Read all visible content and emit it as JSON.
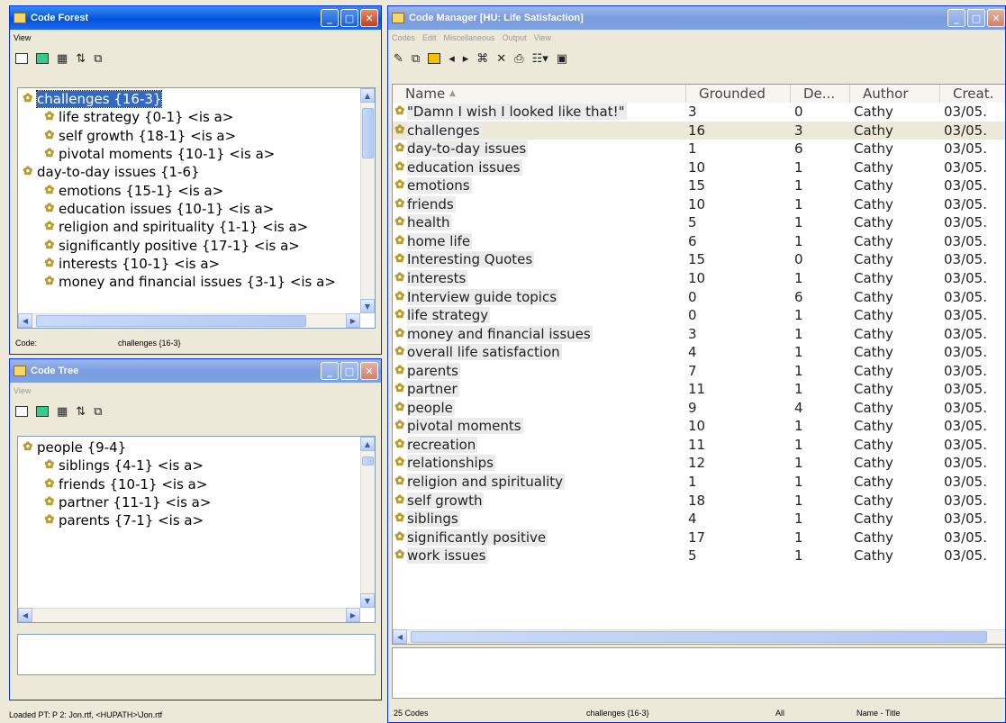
{
  "code_forest": {
    "title": "Code Forest",
    "menu": [
      "View"
    ],
    "tree": [
      {
        "label": "challenges {16-3}",
        "level": 0,
        "selected": true
      },
      {
        "label": "life strategy {0-1} <is a>",
        "level": 1
      },
      {
        "label": "self growth {18-1} <is a>",
        "level": 1
      },
      {
        "label": "pivotal moments {10-1} <is a>",
        "level": 1
      },
      {
        "label": "day-to-day issues {1-6}",
        "level": 0
      },
      {
        "label": "emotions {15-1} <is a>",
        "level": 1
      },
      {
        "label": "education issues {10-1} <is a>",
        "level": 1
      },
      {
        "label": "religion and spirituality {1-1} <is a>",
        "level": 1
      },
      {
        "label": "significantly positive {17-1} <is a>",
        "level": 1
      },
      {
        "label": "interests {10-1} <is a>",
        "level": 1
      },
      {
        "label": "money and financial issues {3-1} <is a>",
        "level": 1
      }
    ],
    "status_label": "Code:",
    "status_value": "challenges {16-3}"
  },
  "code_tree": {
    "title": "Code Tree",
    "menu": [
      "View"
    ],
    "tree": [
      {
        "label": "people {9-4}",
        "level": 0
      },
      {
        "label": "siblings {4-1} <is a>",
        "level": 1
      },
      {
        "label": "friends {10-1} <is a>",
        "level": 1
      },
      {
        "label": "partner {11-1} <is a>",
        "level": 1
      },
      {
        "label": "parents {7-1} <is a>",
        "level": 1
      }
    ]
  },
  "bottom_status": "Loaded PT: P 2: Jon.rtf, <HUPATH>\\Jon.rtf",
  "code_manager": {
    "title": "Code Manager [HU: Life Satisfaction]",
    "menu": [
      "Codes",
      "Edit",
      "Miscellaneous",
      "Output",
      "View"
    ],
    "columns": [
      "Name",
      "Grounded",
      "De...",
      "Author",
      "Creat."
    ],
    "rows": [
      [
        "\"Damn I wish I looked like that!\"",
        "3",
        "0",
        "Cathy",
        "03/05."
      ],
      [
        "challenges",
        "16",
        "3",
        "Cathy",
        "03/05."
      ],
      [
        "day-to-day issues",
        "1",
        "6",
        "Cathy",
        "03/05."
      ],
      [
        "education issues",
        "10",
        "1",
        "Cathy",
        "03/05."
      ],
      [
        "emotions",
        "15",
        "1",
        "Cathy",
        "03/05."
      ],
      [
        "friends",
        "10",
        "1",
        "Cathy",
        "03/05."
      ],
      [
        "health",
        "5",
        "1",
        "Cathy",
        "03/05."
      ],
      [
        "home life",
        "6",
        "1",
        "Cathy",
        "03/05."
      ],
      [
        "Interesting Quotes",
        "15",
        "0",
        "Cathy",
        "03/05."
      ],
      [
        "interests",
        "10",
        "1",
        "Cathy",
        "03/05."
      ],
      [
        "Interview guide topics",
        "0",
        "6",
        "Cathy",
        "03/05."
      ],
      [
        "life strategy",
        "0",
        "1",
        "Cathy",
        "03/05."
      ],
      [
        "money and financial issues",
        "3",
        "1",
        "Cathy",
        "03/05."
      ],
      [
        "overall life satisfaction",
        "4",
        "1",
        "Cathy",
        "03/05."
      ],
      [
        "parents",
        "7",
        "1",
        "Cathy",
        "03/05."
      ],
      [
        "partner",
        "11",
        "1",
        "Cathy",
        "03/05."
      ],
      [
        "people",
        "9",
        "4",
        "Cathy",
        "03/05."
      ],
      [
        "pivotal moments",
        "10",
        "1",
        "Cathy",
        "03/05."
      ],
      [
        "recreation",
        "11",
        "1",
        "Cathy",
        "03/05."
      ],
      [
        "relationships",
        "12",
        "1",
        "Cathy",
        "03/05."
      ],
      [
        "religion and spirituality",
        "1",
        "1",
        "Cathy",
        "03/05."
      ],
      [
        "self growth",
        "18",
        "1",
        "Cathy",
        "03/05."
      ],
      [
        "siblings",
        "4",
        "1",
        "Cathy",
        "03/05."
      ],
      [
        "significantly positive",
        "17",
        "1",
        "Cathy",
        "03/05."
      ],
      [
        "work issues",
        "5",
        "1",
        "Cathy",
        "03/05."
      ]
    ],
    "status": [
      "25 Codes",
      "challenges {16-3}",
      "All",
      "Name - Title"
    ]
  }
}
